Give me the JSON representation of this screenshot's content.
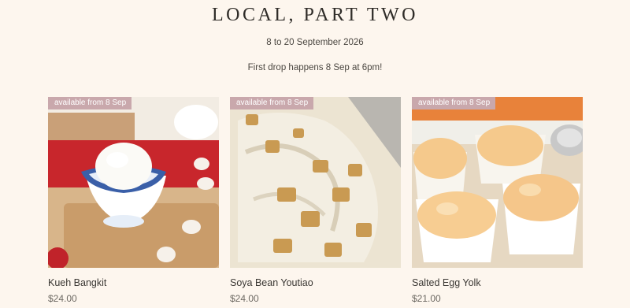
{
  "header": {
    "title": "LOCAL, PART TWO",
    "dates": "8 to 20 September 2026",
    "drop_note": "First drop happens 8 Sep at 6pm!"
  },
  "products": [
    {
      "name": "Kueh Bangkit",
      "price": "$24.00",
      "badge": "available from 8 Sep",
      "image": "kueh-bangkit-ice-cream-bowl"
    },
    {
      "name": "Soya Bean Youtiao",
      "price": "$24.00",
      "badge": "available from 8 Sep",
      "image": "soya-bean-youtiao-ice-cream-tray"
    },
    {
      "name": "Salted Egg Yolk",
      "price": "$21.00",
      "badge": "available from 8 Sep",
      "image": "salted-egg-yolk-ice-cream-cups"
    }
  ],
  "colors": {
    "background": "#fdf6ee",
    "badge": "#c9a8ac",
    "text": "#3a3733",
    "price": "#6d6963"
  }
}
